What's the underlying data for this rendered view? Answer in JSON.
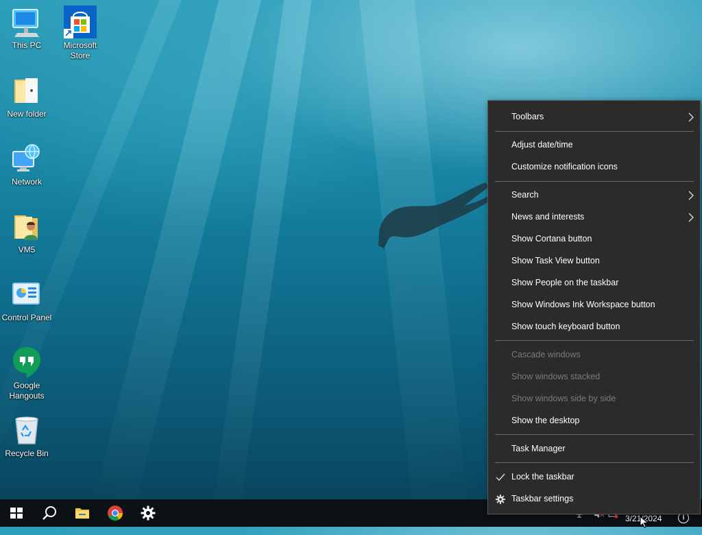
{
  "desktop": {
    "icons": [
      {
        "label": "This PC",
        "icon": "this-pc-icon"
      },
      {
        "label": "Microsoft\nStore",
        "icon": "microsoft-store-icon"
      },
      {
        "label": "New folder",
        "icon": "folder-icon"
      },
      {
        "label": "Network",
        "icon": "network-icon"
      },
      {
        "label": "VM5",
        "icon": "user-folder-icon"
      },
      {
        "label": "Control Panel",
        "icon": "control-panel-icon"
      },
      {
        "label": "Google\nHangouts",
        "icon": "google-hangouts-icon"
      },
      {
        "label": "Recycle Bin",
        "icon": "recycle-bin-icon"
      }
    ]
  },
  "context_menu": {
    "items": [
      {
        "label": "Toolbars",
        "submenu": true
      },
      {
        "label": "Adjust date/time"
      },
      {
        "label": "Customize notification icons"
      },
      {
        "label": "Search",
        "submenu": true
      },
      {
        "label": "News and interests",
        "submenu": true
      },
      {
        "label": "Show Cortana button"
      },
      {
        "label": "Show Task View button"
      },
      {
        "label": "Show People on the taskbar"
      },
      {
        "label": "Show Windows Ink Workspace button"
      },
      {
        "label": "Show touch keyboard button"
      },
      {
        "label": "Cascade windows",
        "disabled": true
      },
      {
        "label": "Show windows stacked",
        "disabled": true
      },
      {
        "label": "Show windows side by side",
        "disabled": true
      },
      {
        "label": "Show the desktop"
      },
      {
        "label": "Task Manager"
      },
      {
        "label": "Lock the taskbar",
        "checked": true
      },
      {
        "label": "Taskbar settings",
        "icon": "gear-icon"
      }
    ]
  },
  "taskbar": {
    "buttons": [
      "windows-start-icon",
      "search-icon",
      "file-explorer-icon",
      "chrome-icon",
      "settings-gear-icon"
    ],
    "tray": {
      "date": "3/21/2024"
    }
  },
  "colors": {
    "menu_bg": "#2b2b2b",
    "menu_text": "#ffffff",
    "menu_disabled": "#7a7a7a",
    "taskbar_bg": "#0c1116"
  }
}
